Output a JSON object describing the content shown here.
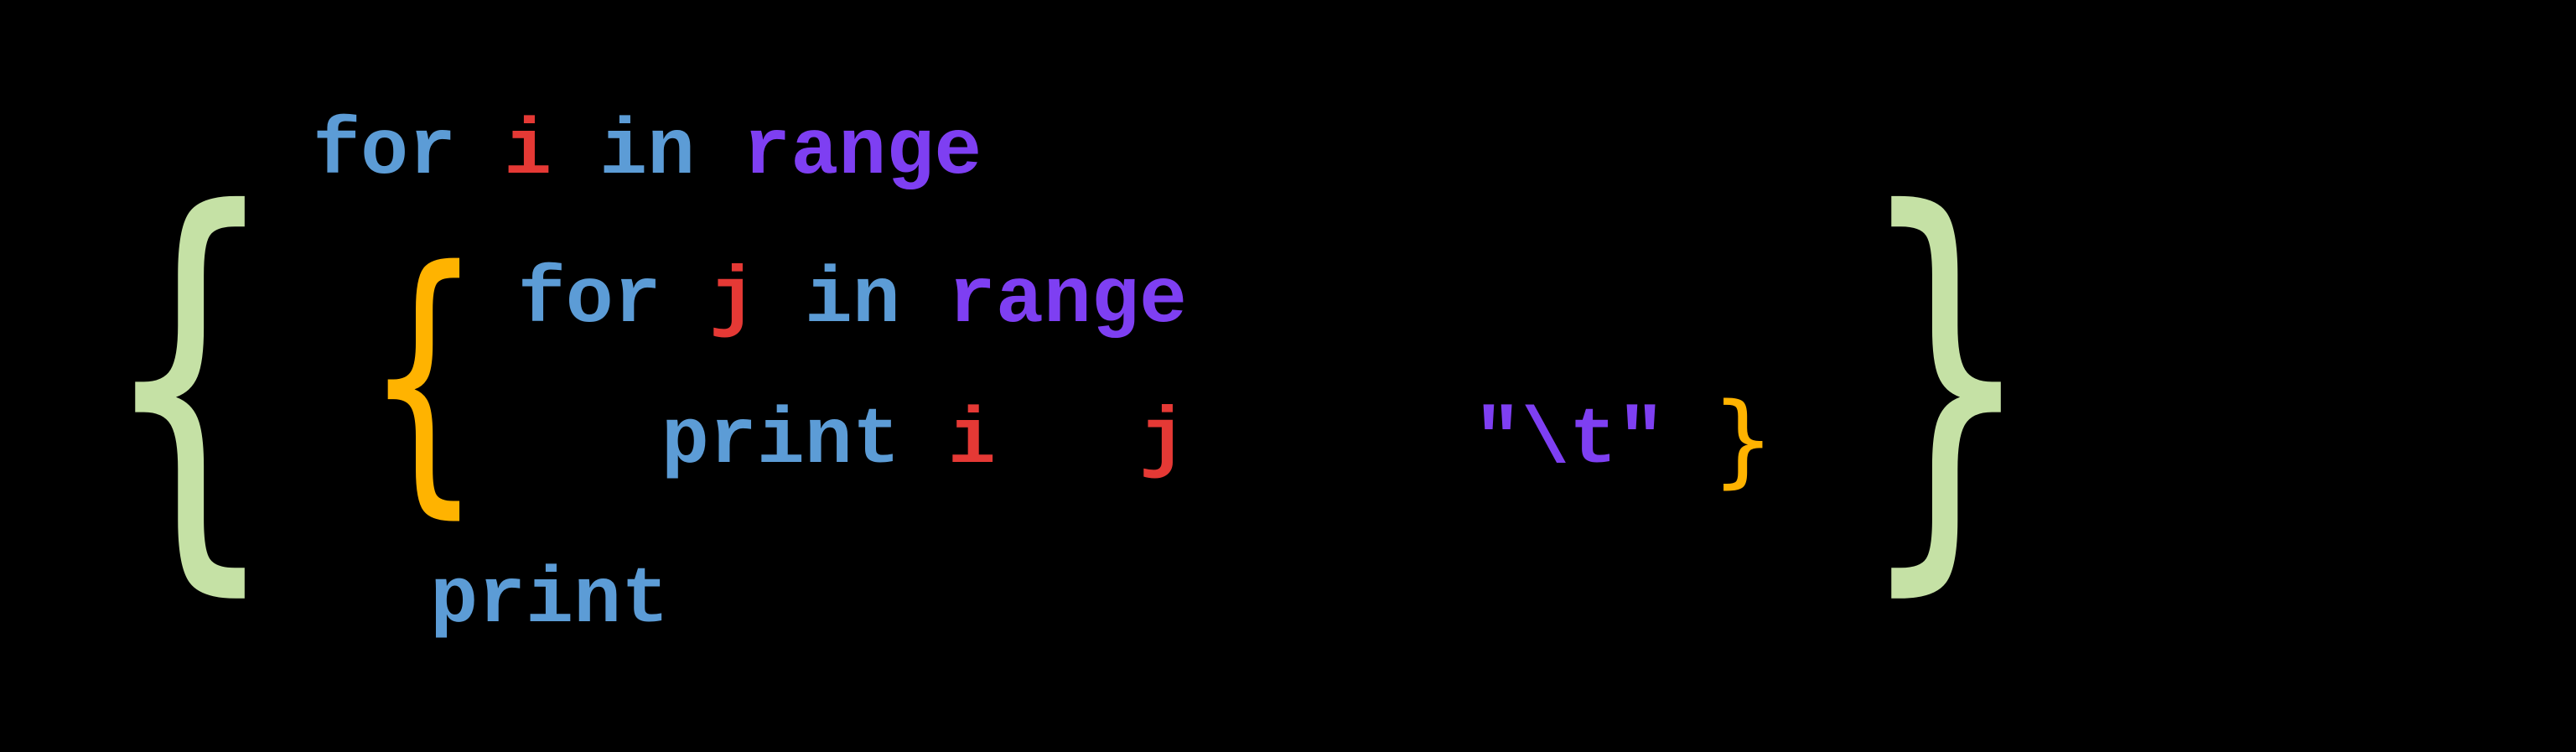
{
  "code": {
    "line1": {
      "for": "for",
      "var": "i",
      "in": "in",
      "range": "range"
    },
    "inner": {
      "line1": {
        "for": "for",
        "var": "j",
        "in": "in",
        "range": "range"
      },
      "line2": {
        "print": "print",
        "var1": "i",
        "var2": "j",
        "string": "\"\\t\""
      }
    },
    "line3": {
      "print": "print"
    }
  },
  "braces": {
    "outer_left": "{",
    "outer_right": "}",
    "inner_left": "{",
    "inner_right": "}"
  }
}
